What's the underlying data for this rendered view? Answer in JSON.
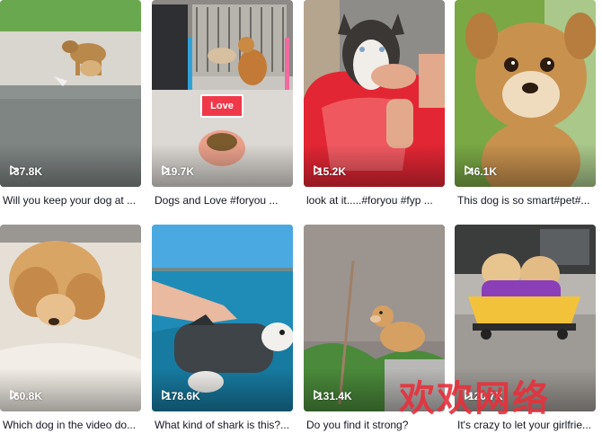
{
  "videos": [
    {
      "views": "37.8K",
      "caption": "Will you keep your dog at ...",
      "scene": "two dogs walking on a porch"
    },
    {
      "views": "19.7K",
      "caption": "Dogs and Love #foryou ...",
      "tag": "Love",
      "scene": "puppy beside kennel with food bowl"
    },
    {
      "views": "15.2K",
      "caption": "look at it.....#foryou #fyp ...",
      "scene": "husky in red tub with hand"
    },
    {
      "views": "46.1K",
      "caption": "This dog is so smart#pet#...",
      "scene": "golden puppy close-up"
    },
    {
      "views": "60.8K",
      "caption": "Which dog in the video do...",
      "scene": "fluffy puppy on sand"
    },
    {
      "views": "178.6K",
      "caption": "What kind of shark is this?...",
      "scene": "dog in shark life vest in sea"
    },
    {
      "views": "131.4K",
      "caption": "Do you find it strong?",
      "scene": "puppy on wooden post"
    },
    {
      "views": "120.7K",
      "caption": "It's crazy to let your girlfrie...",
      "scene": "two pomeranians on skateboard"
    }
  ],
  "watermark": "欢欢网络",
  "icon": "play-icon"
}
